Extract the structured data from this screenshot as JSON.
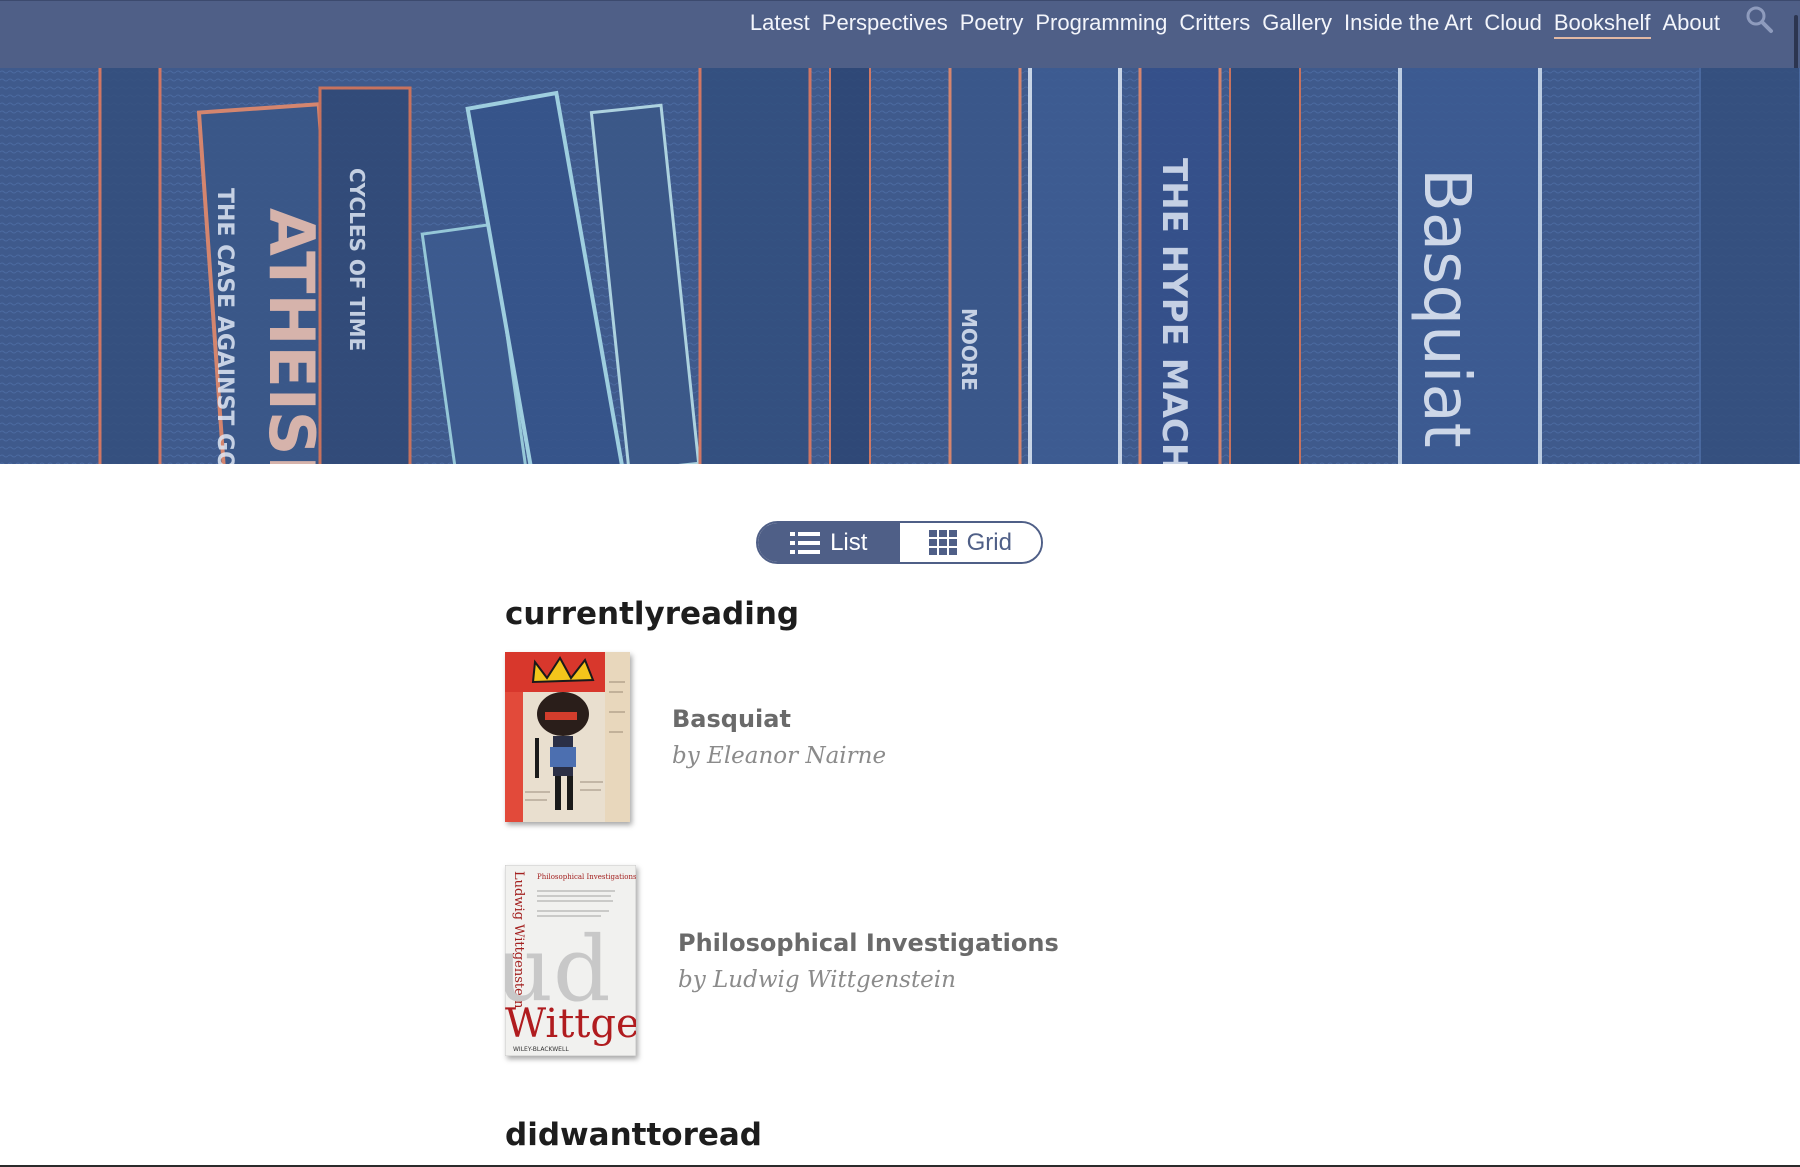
{
  "nav": {
    "items": [
      {
        "label": "Latest"
      },
      {
        "label": "Perspectives"
      },
      {
        "label": "Poetry"
      },
      {
        "label": "Programming"
      },
      {
        "label": "Critters"
      },
      {
        "label": "Gallery"
      },
      {
        "label": "Inside the Art"
      },
      {
        "label": "Cloud"
      },
      {
        "label": "Bookshelf",
        "active": true
      },
      {
        "label": "About"
      }
    ],
    "search_icon": "search-icon"
  },
  "hero": {
    "spine_texts": [
      "ATHEISM",
      "THE CASE AGAINST GOD",
      "CYCLES OF TIME",
      "THE HYPE MACHINE",
      "Basquiat",
      "MOORE"
    ]
  },
  "view_toggle": {
    "list_label": "List",
    "grid_label": "Grid",
    "selected": "List",
    "list_icon": "list-icon",
    "grid_icon": "grid-icon"
  },
  "sections": [
    {
      "title": "currentlyreading",
      "books": [
        {
          "title": "Basquiat",
          "author": "by Eleanor Nairne"
        },
        {
          "title": "Philosophical Investigations",
          "author": "by Ludwig Wittgenstein"
        }
      ]
    },
    {
      "title": "didwanttoread",
      "books": []
    }
  ],
  "covers": {
    "wittgenstein": {
      "author_vertical": "Ludwig Wittgenstein",
      "subtitle": "Philosophical Investigations",
      "big_word": "Wittge",
      "publisher": "WILEY-BLACKWELL"
    }
  },
  "colors": {
    "nav_bg": "#4f5f87",
    "accent_underline": "#e2b9a4",
    "toggle_selected": "#4f5f87"
  }
}
